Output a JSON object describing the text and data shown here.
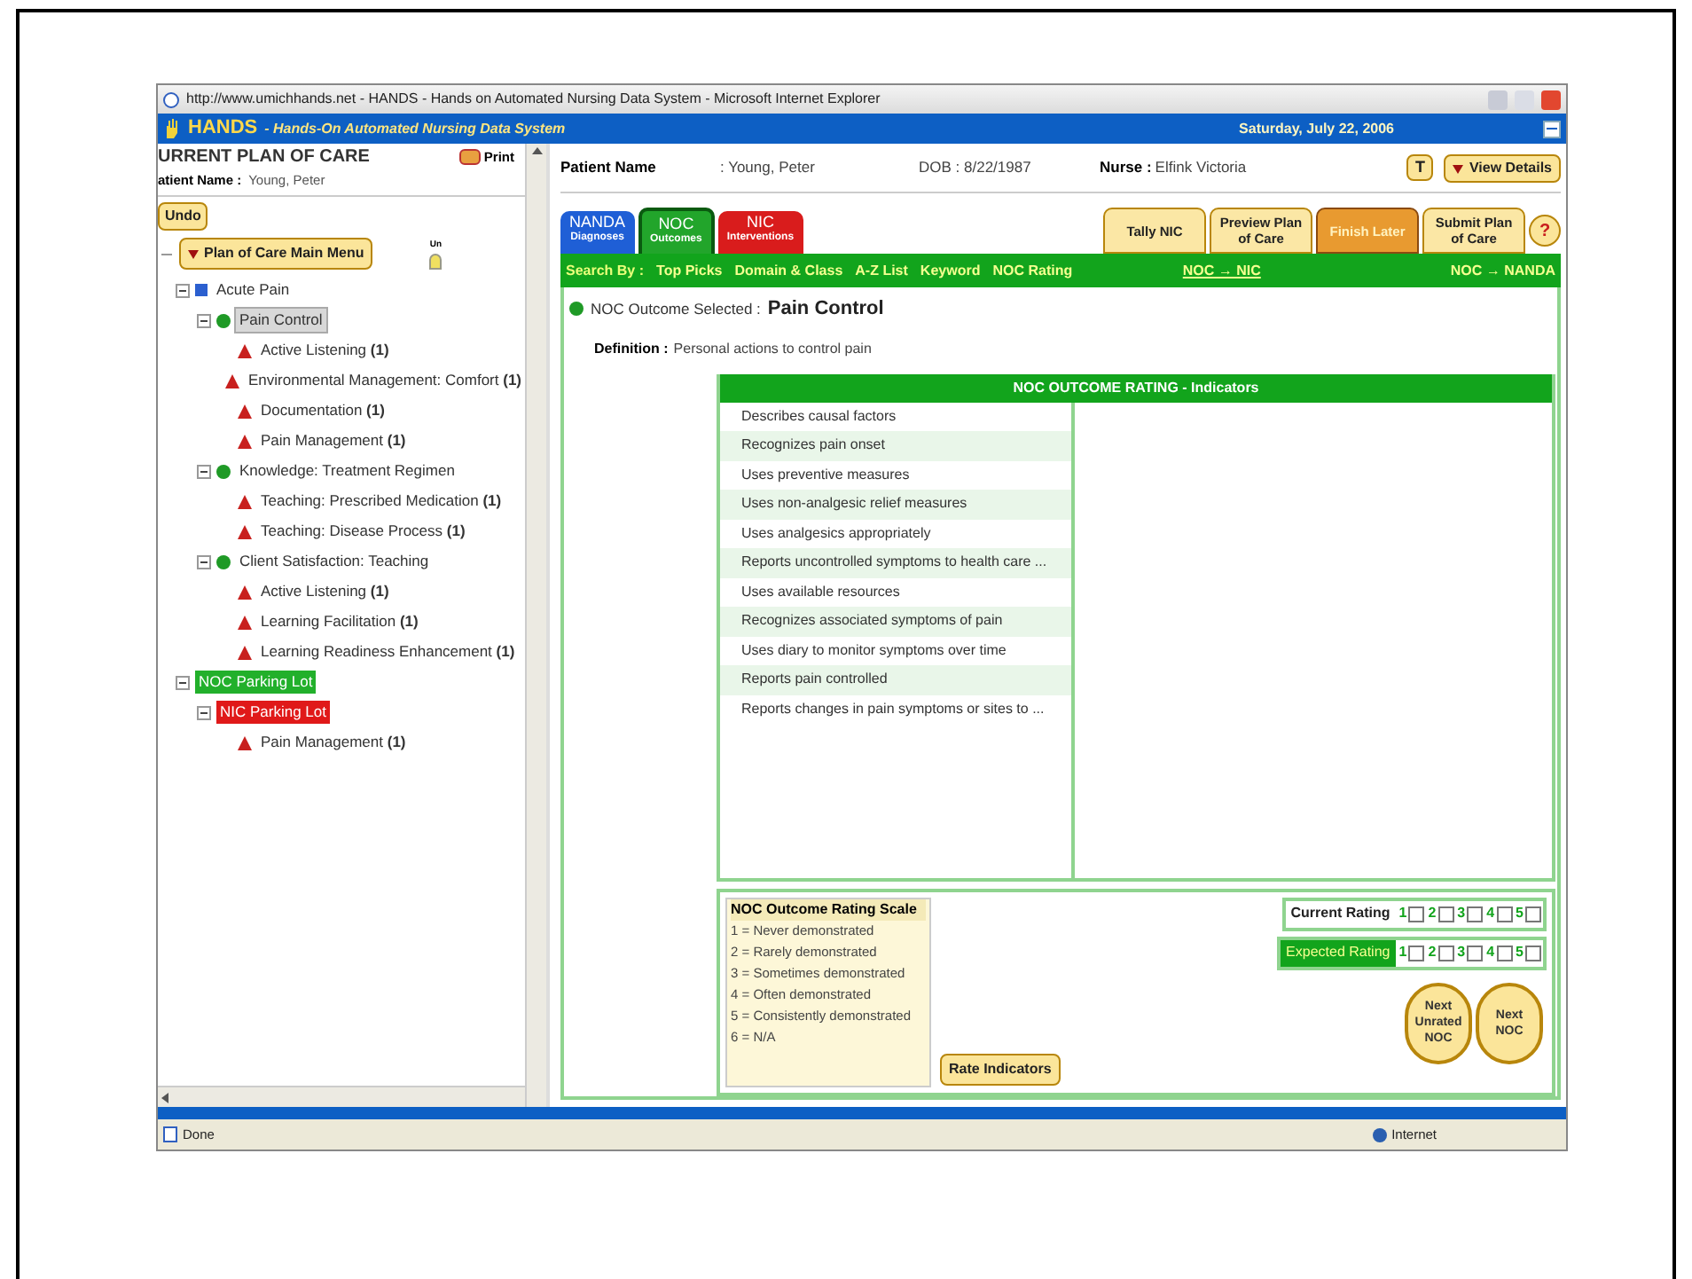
{
  "window": {
    "title": "http://www.umichhands.net - HANDS - Hands on Automated Nursing Data System - Microsoft Internet Explorer"
  },
  "app_header": {
    "name": "HANDS",
    "subtitle": "- Hands-On Automated Nursing Data System",
    "date": "Saturday, July 22, 2006"
  },
  "sidebar": {
    "heading": "URRENT PLAN OF CARE",
    "print_button": "Print",
    "patient_label": "atient Name :",
    "patient_value": "Young, Peter",
    "undo_button": "Undo",
    "main_menu_button": "Plan of Care Main Menu",
    "bulb_label": "Un",
    "tree": [
      {
        "kind": "diagnosis",
        "label": "Acute Pain",
        "selected": false,
        "children": [
          {
            "kind": "outcome",
            "label": "Pain Control",
            "selected": true,
            "children": [
              {
                "kind": "intervention",
                "label": "Active Listening **(1)**",
                "selected": false
              },
              {
                "kind": "intervention",
                "label": "Environmental Management: Comfort **(1)**",
                "selected": false
              },
              {
                "kind": "intervention",
                "label": "Documentation **(1)**",
                "selected": false
              },
              {
                "kind": "intervention",
                "label": "Pain Management **(1)**",
                "selected": false
              }
            ]
          },
          {
            "kind": "outcome",
            "label": "Knowledge: Treatment Regimen",
            "selected": false,
            "children": [
              {
                "kind": "intervention",
                "label": "Teaching: Prescribed Medication **(1)**",
                "selected": false
              },
              {
                "kind": "intervention",
                "label": "Teaching: Disease Process **(1)**",
                "selected": false
              }
            ]
          },
          {
            "kind": "outcome",
            "label": "Client Satisfaction: Teaching",
            "selected": false,
            "children": [
              {
                "kind": "intervention",
                "label": "Active Listening **(1)**",
                "selected": false
              },
              {
                "kind": "intervention",
                "label": "Learning Facilitation **(1)**",
                "selected": false
              },
              {
                "kind": "intervention",
                "label": "Learning Readiness Enhancement **(1)**",
                "selected": false
              }
            ]
          }
        ]
      },
      {
        "kind": "noc_lot",
        "label": "NOC Parking Lot",
        "selected": false,
        "children": [
          {
            "kind": "nic_lot",
            "label": "NIC Parking Lot",
            "selected": false,
            "children": [
              {
                "kind": "intervention",
                "label": "Pain Management **(1)**",
                "selected": false
              }
            ]
          }
        ]
      }
    ]
  },
  "patient": {
    "name_label": "Patient Name",
    "name_value": ": Young, Peter",
    "dob": "DOB : 8/22/1987",
    "nurse_label": "Nurse :",
    "nurse_value": "Elfink Victoria",
    "t_button": "T",
    "view_details_button": "View Details"
  },
  "tabs": [
    {
      "top": "NANDA",
      "bottom": "Diagnoses",
      "color": "#1f5fd6",
      "selected": false
    },
    {
      "top": "NOC",
      "bottom": "Outcomes",
      "color": "#22a52b",
      "selected": true
    },
    {
      "top": "NIC",
      "bottom": "Interventions",
      "color": "#d91c1c",
      "selected": false
    }
  ],
  "actions": [
    {
      "label": "Tally NIC",
      "highlighted": false
    },
    {
      "label": "Preview Plan of Care",
      "highlighted": false
    },
    {
      "label": "Finish Later",
      "highlighted": true
    },
    {
      "label": "Submit Plan of Care",
      "highlighted": false
    }
  ],
  "help_button": "?",
  "search_bar": {
    "label": "Search By :",
    "links": [
      "Top Picks",
      "Domain & Class",
      "A-Z List",
      "Keyword",
      "NOC Rating"
    ],
    "noc_nic": "NOC → NIC",
    "noc_nanda": "NOC → NANDA"
  },
  "outcome": {
    "label": "NOC Outcome Selected :",
    "value": "Pain Control",
    "definition_label": "Definition :",
    "definition_value": "Personal actions to control pain"
  },
  "indicators": {
    "title": "NOC OUTCOME RATING - Indicators",
    "rows": [
      "Describes causal factors",
      "Recognizes pain onset",
      "Uses preventive measures",
      "Uses non-analgesic relief measures",
      "Uses analgesics appropriately",
      "Reports uncontrolled symptoms to health care ...",
      "Uses available resources",
      "Recognizes associated symptoms of pain",
      "Uses diary to monitor symptoms over time",
      "Reports pain controlled",
      "Reports changes in pain symptoms or sites to ..."
    ]
  },
  "rating_scale": {
    "title": "NOC Outcome Rating Scale",
    "lines": [
      "1 = Never demonstrated",
      "2 = Rarely demonstrated",
      "3 = Sometimes demonstrated",
      "4 = Often demonstrated",
      "5 = Consistently demonstrated",
      "6 = N/A"
    ]
  },
  "rate_button": "Rate Indicators",
  "ratings": [
    {
      "label": "Current Rating",
      "highlighted": false,
      "options": [
        {
          "label": "1",
          "checked": false
        },
        {
          "label": "2",
          "checked": false
        },
        {
          "label": "3",
          "checked": false
        },
        {
          "label": "4",
          "checked": false
        },
        {
          "label": "5",
          "checked": false
        }
      ]
    },
    {
      "label": "Expected Rating",
      "highlighted": true,
      "options": [
        {
          "label": "1",
          "checked": false
        },
        {
          "label": "2",
          "checked": false
        },
        {
          "label": "3",
          "checked": false
        },
        {
          "label": "4",
          "checked": false
        },
        {
          "label": "5",
          "checked": false
        }
      ]
    }
  ],
  "next_buttons": [
    "Next Unrated NOC",
    "Next NOC"
  ],
  "status_bar": {
    "left": "Done",
    "right": "Internet"
  }
}
